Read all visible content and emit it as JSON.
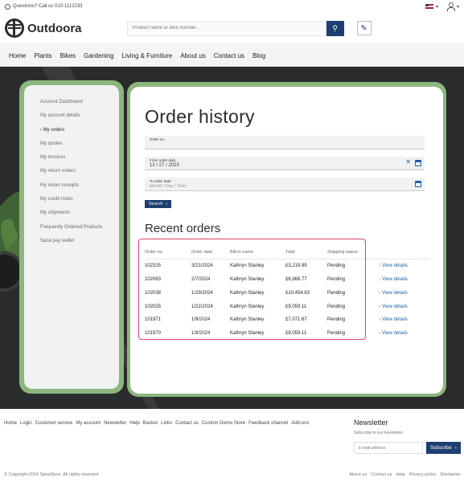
{
  "topbar": {
    "contact": "Questions? Call us 010-1112233"
  },
  "header": {
    "logo_text": "Outdoora",
    "search_placeholder": "Product name or item number..."
  },
  "nav": [
    "Home",
    "Plants",
    "Bikes",
    "Gardening",
    "Living & Furniture",
    "About us",
    "Contact us",
    "Blog"
  ],
  "sidebar": [
    {
      "label": "Account Dashboard"
    },
    {
      "label": "My account details"
    },
    {
      "label": "› My orders"
    },
    {
      "label": "My quotes"
    },
    {
      "label": "My invoices"
    },
    {
      "label": "My return orders"
    },
    {
      "label": "My return receipts"
    },
    {
      "label": "My credit notes"
    },
    {
      "label": "My shipments"
    },
    {
      "label": "Frequently Ordered Products"
    },
    {
      "label": "Sana pay wallet"
    }
  ],
  "main": {
    "title": "Order history",
    "order_no_label": "Order no.",
    "from_date_label": "From order date",
    "from_date_value": "12 / 27 / 2023",
    "to_date_label": "To order date",
    "to_date_placeholder": "Month / Day / Year",
    "search_button": "Search",
    "recent_title": "Recent orders",
    "columns": [
      "Order no.",
      "Order date",
      "Bill-to name",
      "Total",
      "Shipping status"
    ],
    "view_details": "View details",
    "orders": [
      {
        "no": "102315",
        "date": "3/21/2024",
        "name": "Kathryn Stanley",
        "total": "£3,219.99",
        "status": "Pending"
      },
      {
        "no": "102083",
        "date": "2/7/2024",
        "name": "Kathryn Stanley",
        "total": "£6,968.77",
        "status": "Pending"
      },
      {
        "no": "102038",
        "date": "1/29/2024",
        "name": "Kathryn Stanley",
        "total": "£10,454.63",
        "status": "Pending"
      },
      {
        "no": "102025",
        "date": "1/22/2024",
        "name": "Kathryn Stanley",
        "total": "£9,059.11",
        "status": "Pending"
      },
      {
        "no": "101971",
        "date": "1/9/2024",
        "name": "Kathryn Stanley",
        "total": "£7,071.67",
        "status": "Pending"
      },
      {
        "no": "101970",
        "date": "1/9/2024",
        "name": "Kathryn Stanley",
        "total": "£9,059.11",
        "status": "Pending"
      }
    ]
  },
  "footer": {
    "links": [
      "Home",
      "Login",
      "Customer service",
      "My account",
      "Newsletter",
      "Help",
      "Basket",
      "Links",
      "Contact us",
      "Custom Demo Store",
      "Feedback channel",
      "Add-ons"
    ],
    "newsletter_title": "Newsletter",
    "newsletter_text": "Subscribe to our newsletter.",
    "email_placeholder": "E-mail address",
    "subscribe_button": "Subscribe",
    "copyright": "© Copyright 2024 SanaStore. All rights reserved.",
    "bottom_links": [
      "About us",
      "Contact us",
      "Help",
      "Privacy policy",
      "Disclaimer"
    ]
  },
  "colors": {
    "brand_blue": "#1f3f73",
    "frame_green": "#8db67e",
    "highlight": "#d9426b"
  }
}
